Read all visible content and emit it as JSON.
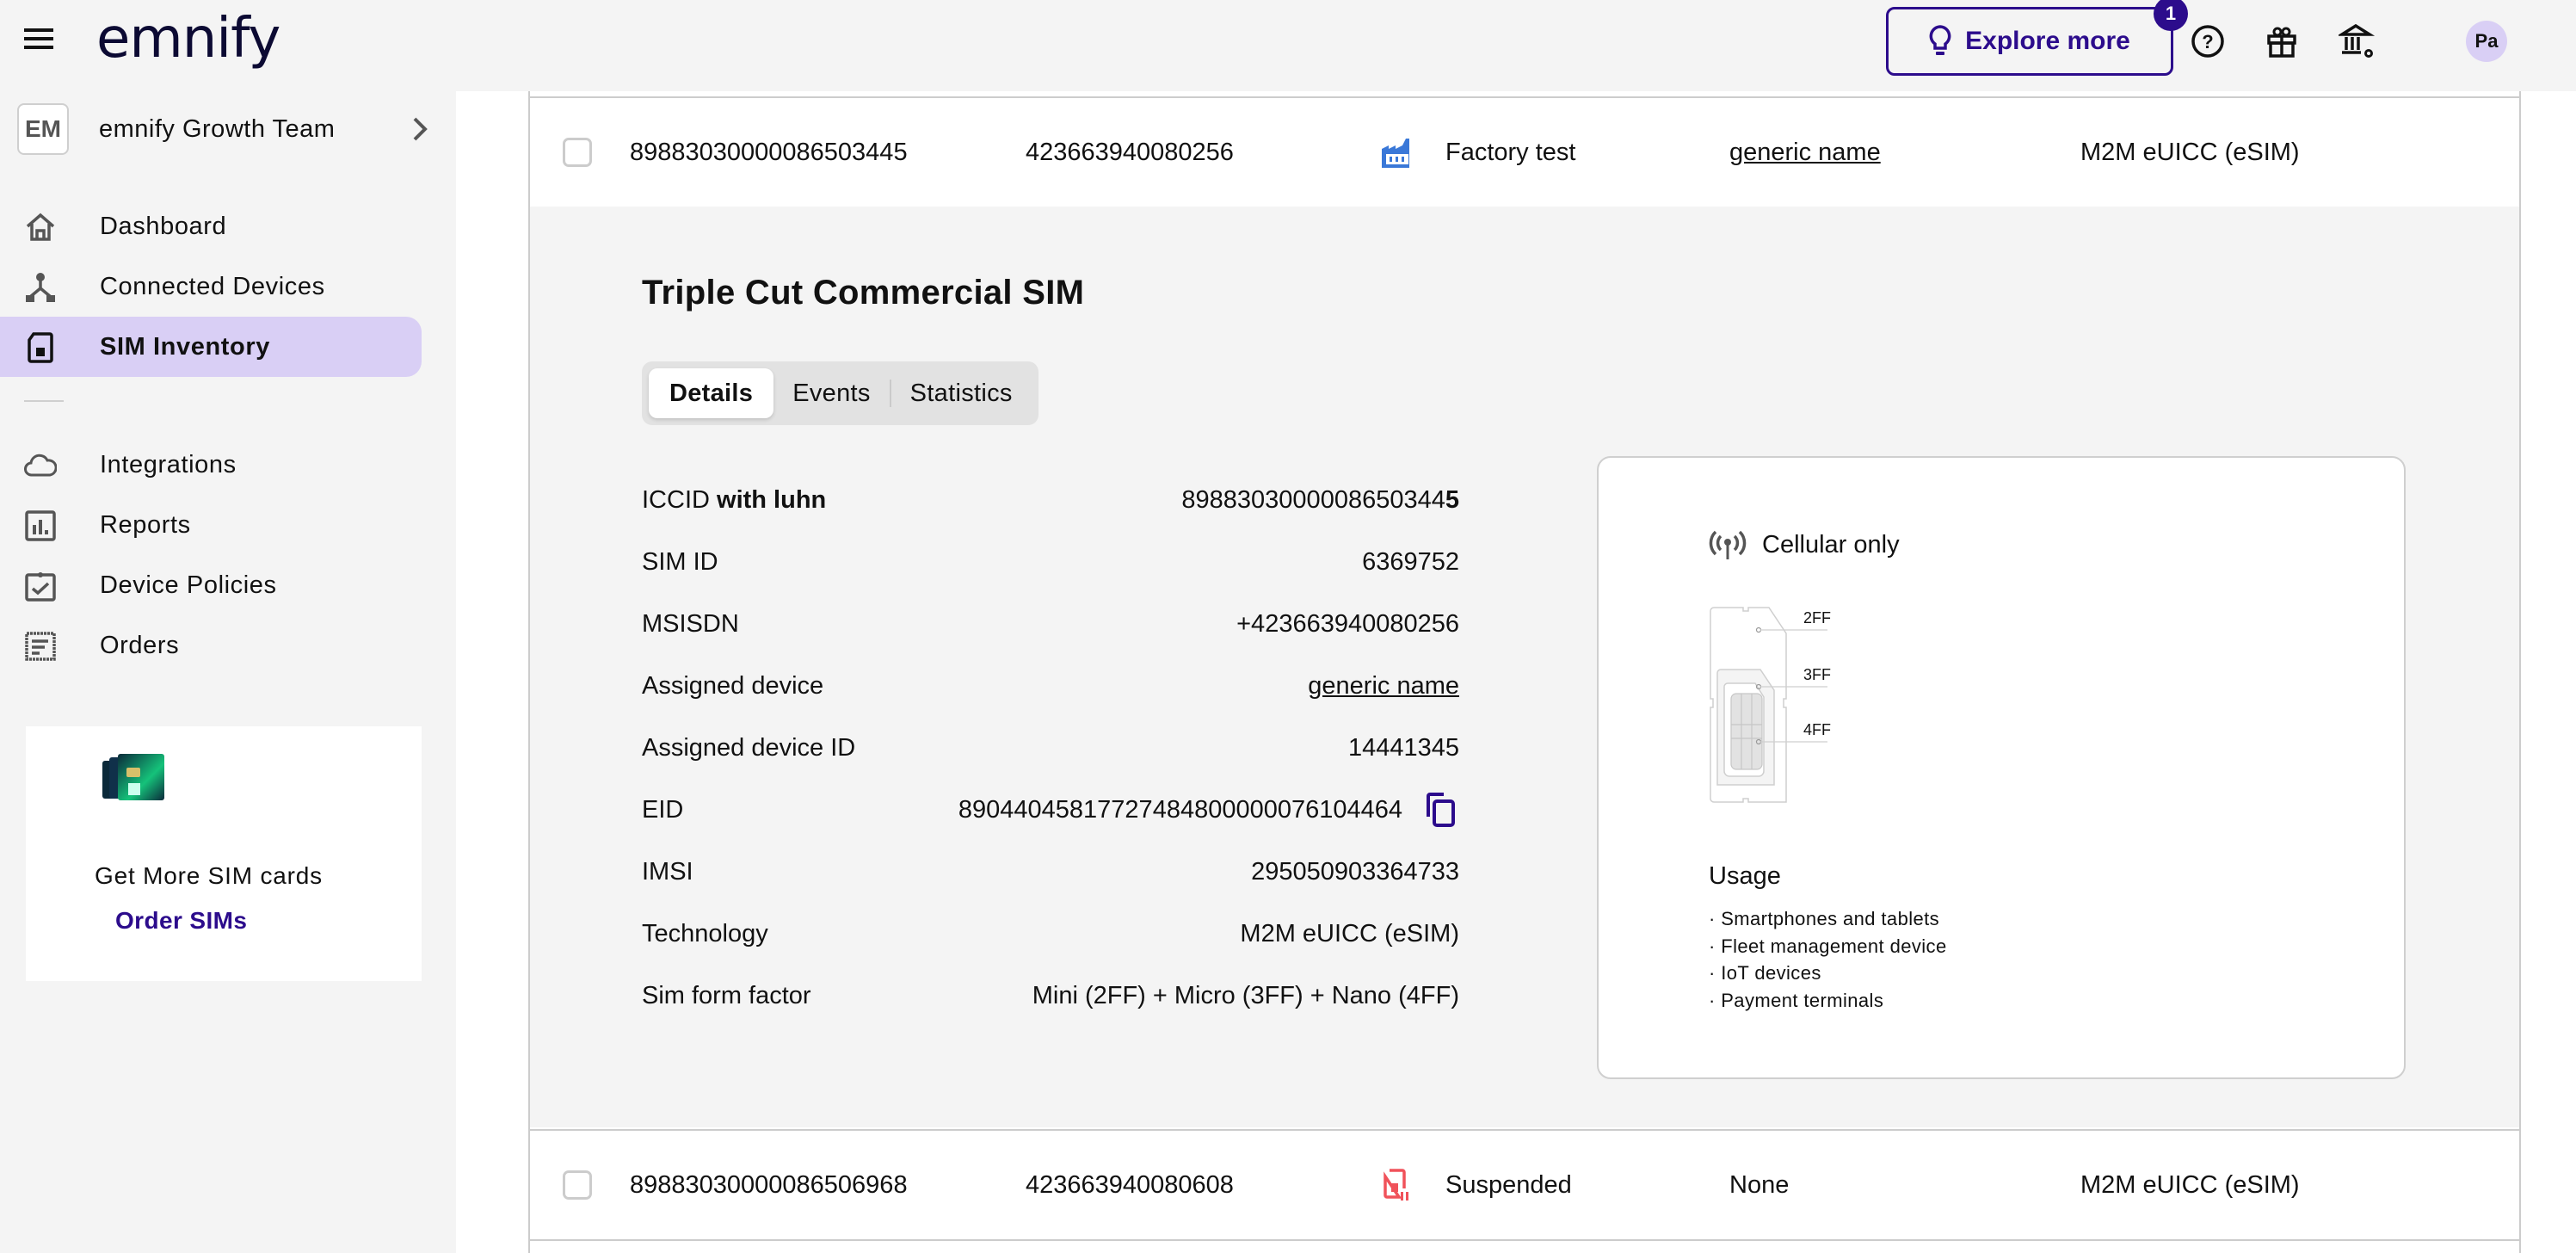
{
  "header": {
    "logo": "emnify",
    "explore_label": "Explore more",
    "explore_badge": "1",
    "avatar_initials": "Pa",
    "colors": {
      "brand": "#2c0c8c",
      "active_nav": "#d9cff5"
    }
  },
  "sidebar": {
    "org": {
      "badge": "EM",
      "name": "emnify Growth Team"
    },
    "items": [
      {
        "label": "Dashboard",
        "icon": "home-icon"
      },
      {
        "label": "Connected Devices",
        "icon": "connected-devices-icon"
      },
      {
        "label": "SIM Inventory",
        "icon": "sim-card-icon",
        "active": true
      },
      {
        "label": "Integrations",
        "icon": "cloud-icon"
      },
      {
        "label": "Reports",
        "icon": "bar-chart-icon"
      },
      {
        "label": "Device Policies",
        "icon": "clipboard-check-icon"
      },
      {
        "label": "Orders",
        "icon": "receipt-icon"
      }
    ],
    "promo": {
      "text": "Get More SIM cards",
      "link": "Order SIMs"
    }
  },
  "table": {
    "rows": [
      {
        "iccid": "89883030000086503445",
        "msisdn": "423663940080256",
        "status": "Factory test",
        "status_icon": "factory-icon",
        "status_color": "#3a78d8",
        "device": "generic name",
        "device_is_link": true,
        "technology": "M2M eUICC (eSIM)"
      },
      {
        "iccid": "89883030000086506968",
        "msisdn": "423663940080608",
        "status": "Suspended",
        "status_icon": "sim-suspended-icon",
        "status_color": "#f0525a",
        "device": "None",
        "device_is_link": false,
        "technology": "M2M eUICC (eSIM)"
      }
    ]
  },
  "detail": {
    "title": "Triple Cut Commercial SIM",
    "tabs": [
      {
        "label": "Details",
        "active": true
      },
      {
        "label": "Events"
      },
      {
        "label": "Statistics"
      }
    ],
    "fields": {
      "iccid_label": "ICCID",
      "iccid_label_bold": "with luhn",
      "iccid_value": "8988303000008650344",
      "iccid_luhn_digit": "5",
      "sim_id_label": "SIM ID",
      "sim_id_value": "6369752",
      "msisdn_label": "MSISDN",
      "msisdn_value": "+423663940080256",
      "device_label": "Assigned device",
      "device_value": "generic name",
      "device_id_label": "Assigned device ID",
      "device_id_value": "14441345",
      "eid_label": "EID",
      "eid_value": "89044045817727484800000076104464",
      "imsi_label": "IMSI",
      "imsi_value": "295050903364733",
      "technology_label": "Technology",
      "technology_value": "M2M eUICC (eSIM)",
      "form_factor_label": "Sim form factor",
      "form_factor_value": "Mini (2FF) + Micro (3FF) + Nano (4FF)"
    },
    "sim_card": {
      "connectivity": "Cellular only",
      "form_labels": [
        "2FF",
        "3FF",
        "4FF"
      ],
      "usage_title": "Usage",
      "usage": [
        "· Smartphones and tablets",
        "· Fleet management device",
        "· IoT devices",
        "· Payment terminals"
      ]
    }
  }
}
